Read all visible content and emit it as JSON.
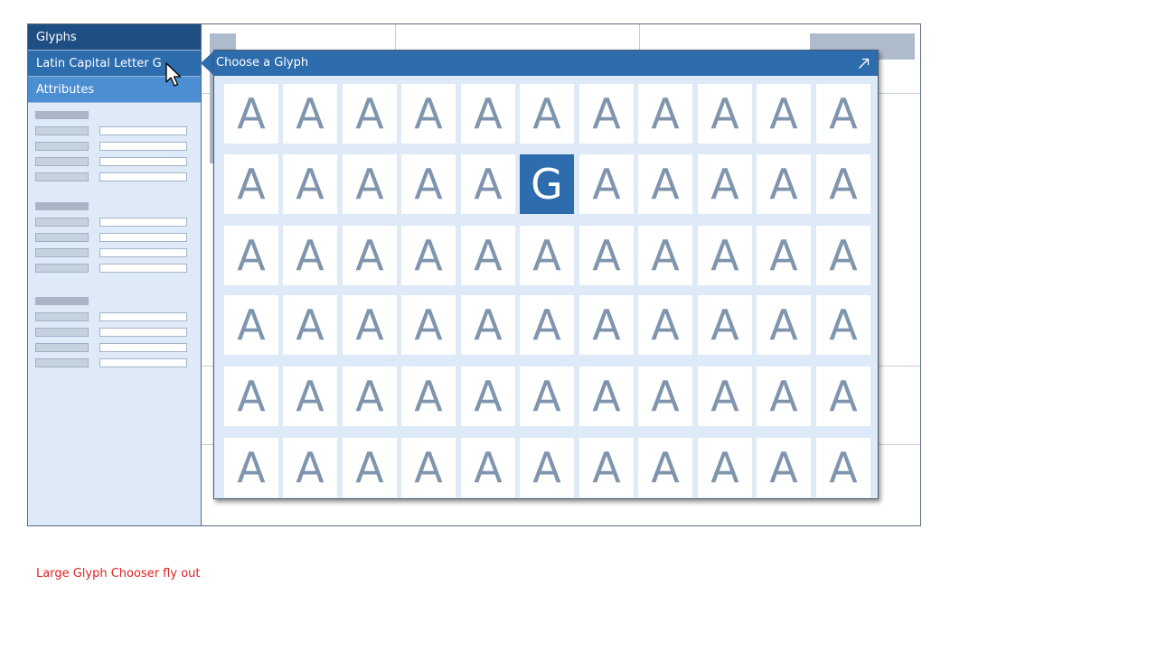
{
  "sidebar": {
    "glyphs_label": "Glyphs",
    "selected_glyph_label": "Latin Capital Letter G",
    "attributes_label": "Attributes",
    "attribute_groups": [
      {
        "rows": 4
      },
      {
        "rows": 4
      },
      {
        "rows": 4
      }
    ]
  },
  "flyout": {
    "title": "Choose a Glyph",
    "expand_icon": "expand-arrow-icon",
    "columns": 11,
    "rows": 6,
    "default_glyph": "A",
    "selected_glyph": "G",
    "selected_index": 16
  },
  "caption": "Large Glyph Chooser fly out",
  "colors": {
    "header_dark": "#1f4f82",
    "header_mid": "#2d6cad",
    "header_light": "#4b8ed2",
    "panel_bg": "#deeaf7",
    "glyph_text": "#7f94ad",
    "caption_red": "#e02020"
  }
}
